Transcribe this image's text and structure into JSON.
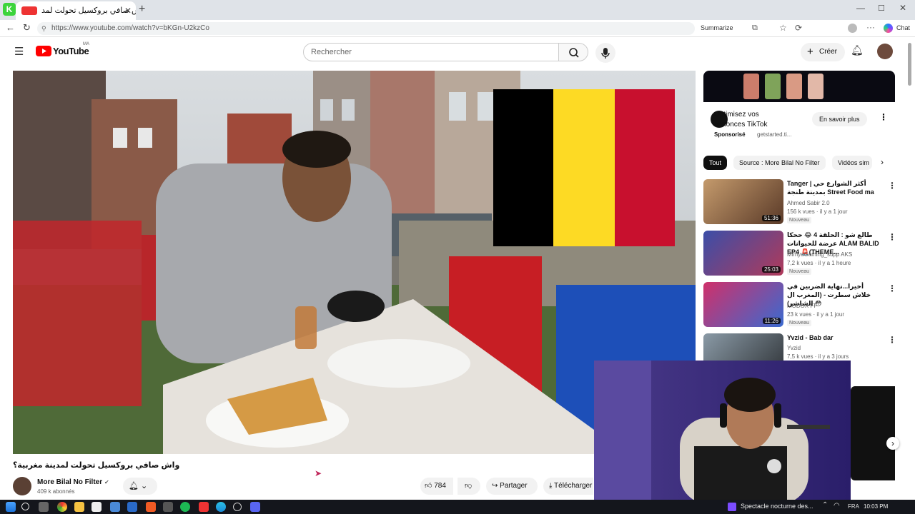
{
  "browser": {
    "tab_title": "واش صافي بروكسيل تحولت لمد",
    "tab_badge": "K",
    "url": "https://www.youtube.com/watch?v=bKGn-U2kzCo",
    "summarize_label": "Summarize",
    "side_label": "Chat"
  },
  "youtube": {
    "logo_text": "YouTube",
    "logo_region": "MA",
    "search_placeholder": "Rechercher",
    "create_label": "Créer"
  },
  "ad": {
    "title_line1": "Optimisez vos",
    "title_line2": "annonces TikTok",
    "sponsor": "Sponsorisé",
    "domain": "getstarted.ti...",
    "cta_label": "En savoir plus"
  },
  "chips": [
    {
      "label": "Tout"
    },
    {
      "label": "Source : More Bilal No Filter"
    },
    {
      "label": "Vidéos sim"
    }
  ],
  "related": [
    {
      "title": "Tanger | أكثر الشوارع حي بمدينة طنجة Street Food ma",
      "channel": "Ahmed Sabir 2.0",
      "meta": "156 k vues · il y a 1 jour",
      "badge": "Nouveau",
      "duration": "51:36"
    },
    {
      "title": "طالع شو : الحلقة 4 😂 ححكا عرضة للحيوانات ALAM BALID EP4 🚨(THEME...",
      "channel": "MimyaGaming_supp AKS",
      "meta": "7,2 k vues · il y a 1 heure",
      "badge": "Nouveau",
      "duration": "25:03"
    },
    {
      "title": "أخيرا...نهاية الضربين في خلاش سطرت - (المغرب ال الشاشر) 😳",
      "channel": "MODOX FF",
      "meta": "23 k vues · il y a 1 jour",
      "badge": "Nouveau",
      "duration": "11:26"
    },
    {
      "title": "Yvzid - Bab dar",
      "channel": "Yvzid",
      "meta": "7,5 k vues · il y a 3 jours",
      "badge": "",
      "duration": ""
    }
  ],
  "video": {
    "title": "واش صافي بروكسيل تحولت لمدينة مغربية؟",
    "channel_name": "More Bilal No Filter",
    "subscribers": "409 k abonnés",
    "likes": "784",
    "share_label": "Partager",
    "download_label": "Télécharger"
  },
  "taskbar": {
    "notification": "Spectacle nocturne des...",
    "lang": "FRA",
    "time": "10:03 PM"
  },
  "colors": {
    "flag_black": "#000000",
    "flag_yellow": "#fdda24",
    "flag_red": "#c8102e",
    "youtube_red": "#ff0000"
  }
}
